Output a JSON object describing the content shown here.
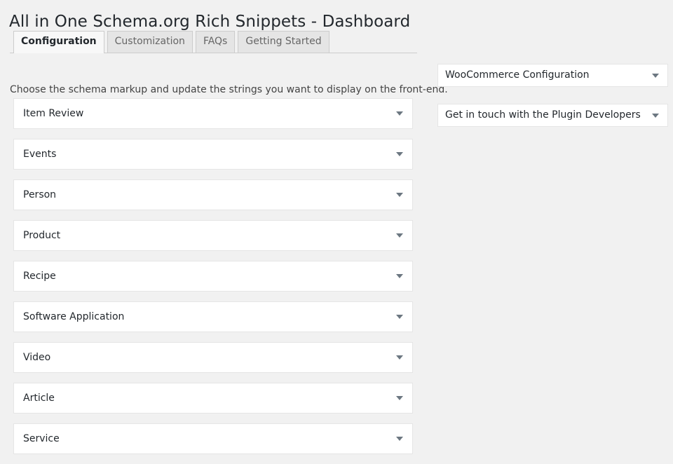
{
  "page": {
    "title": "All in One Schema.org Rich Snippets - Dashboard",
    "background_color": "#f1f1f1"
  },
  "tabs": [
    {
      "label": "Configuration",
      "active": true
    },
    {
      "label": "Customization",
      "active": false
    },
    {
      "label": "FAQs",
      "active": false
    },
    {
      "label": "Getting Started",
      "active": false
    }
  ],
  "description": "Choose the schema markup and update the strings you want to display on the front-end.",
  "schema_accordion": {
    "caret_icon": "chevron-down-icon",
    "items": [
      {
        "label": "Item Review"
      },
      {
        "label": "Events"
      },
      {
        "label": "Person"
      },
      {
        "label": "Product"
      },
      {
        "label": "Recipe"
      },
      {
        "label": "Software Application"
      },
      {
        "label": "Video"
      },
      {
        "label": "Article"
      },
      {
        "label": "Service"
      }
    ]
  },
  "sidebar": {
    "caret_icon": "chevron-down-icon",
    "items": [
      {
        "label": "WooCommerce Configuration"
      },
      {
        "label": "Get in touch with the Plugin Developers"
      }
    ]
  },
  "colors": {
    "panel_background": "#ffffff",
    "panel_border": "#e5e5e5",
    "tab_inactive_background": "#e5e5e5",
    "tab_active_background": "#f8f8f8",
    "text_primary": "#23282d",
    "text_secondary": "#666666",
    "caret": "#6c7781"
  }
}
